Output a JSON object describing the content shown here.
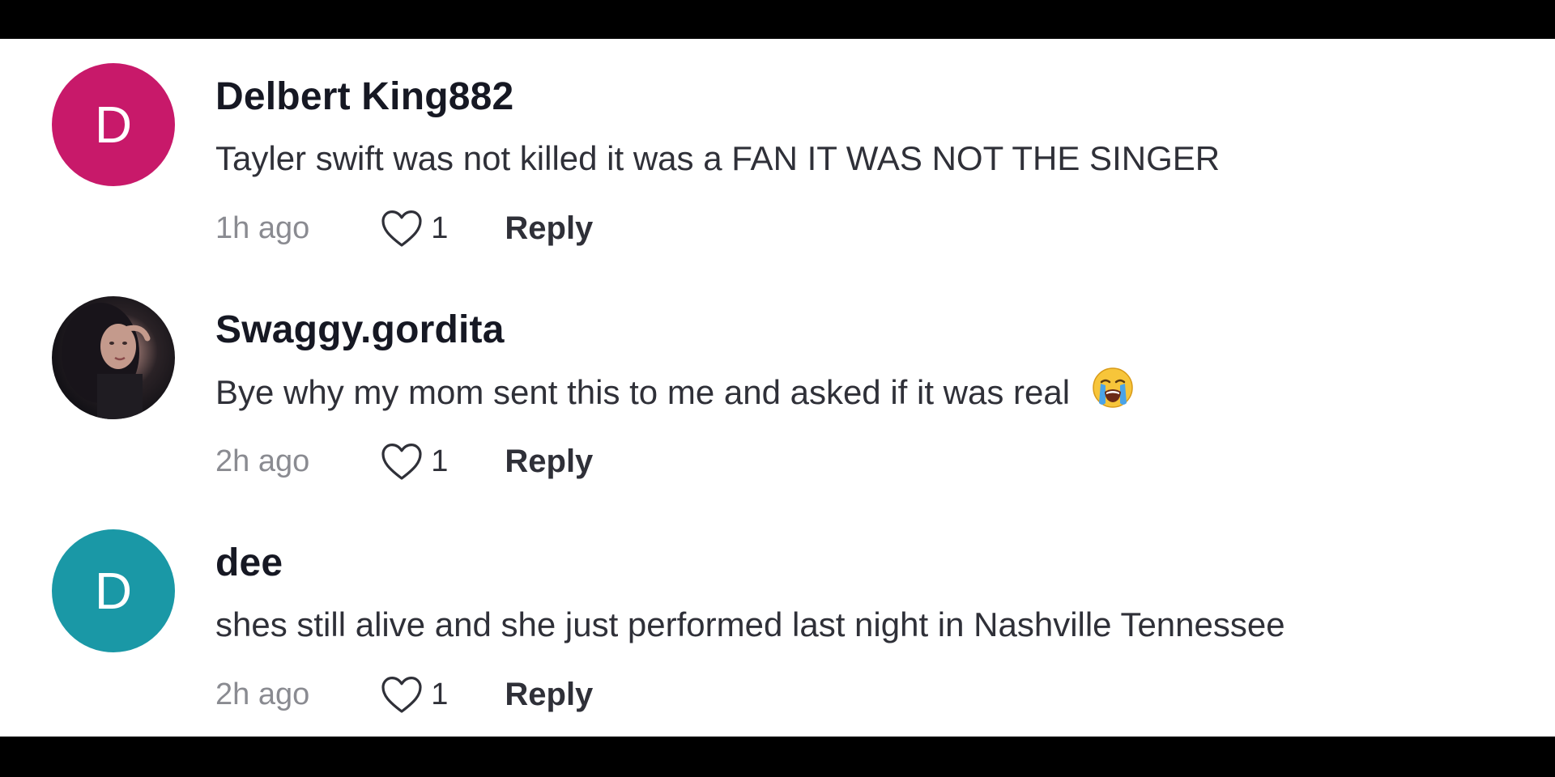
{
  "comments": [
    {
      "avatar_letter": "D",
      "avatar_color": "#c8196a",
      "username": "Delbert King882",
      "text": "Tayler swift was not killed it was a FAN IT WAS NOT THE SINGER",
      "time": "1h ago",
      "likes": "1",
      "reply_label": "Reply"
    },
    {
      "avatar_letter": "",
      "avatar_color": "#141217",
      "username": "Swaggy.gordita",
      "text": "Bye why my mom sent this to me and asked if it was real",
      "emoji": "loudly-crying-face-icon",
      "time": "2h ago",
      "likes": "1",
      "reply_label": "Reply"
    },
    {
      "avatar_letter": "D",
      "avatar_color": "#1a98a6",
      "username": "dee",
      "text": "shes still alive and she just performed last night in Nashville Tennessee",
      "time": "2h ago",
      "likes": "1",
      "reply_label": "Reply"
    }
  ]
}
